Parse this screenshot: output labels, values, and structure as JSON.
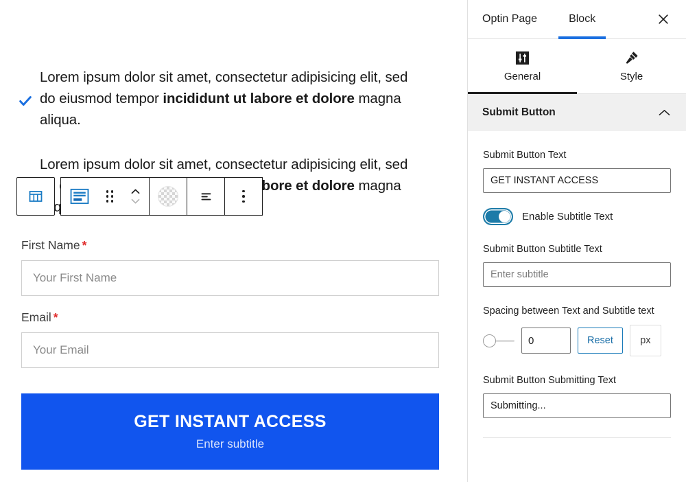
{
  "canvas": {
    "paragraph_1": {
      "part1": "Lorem ipsum dolor sit amet, consectetur adipisicing elit, sed do eiusmod tempor ",
      "bold": "incididunt ut labore et dolore",
      "part2": " magna aliqua."
    },
    "paragraph_2": {
      "part1": "Lorem ipsum dolor sit amet, consectetur adipisicing elit, sed do eiusmod tempor ",
      "bold": "incididunt ut labore et dolore",
      "part2": " magna aliqua."
    },
    "check_icon": "✔",
    "form": {
      "first_name_label": "First Name",
      "first_name_required": "*",
      "first_name_placeholder": "Your First Name",
      "email_label": "Email",
      "email_required": "*",
      "email_placeholder": "Your Email"
    },
    "submit_button": {
      "text": "GET INSTANT ACCESS",
      "subtitle": "Enter subtitle",
      "background_color": "#1155ee"
    },
    "toolbar": {
      "parent_block_icon": "columns-icon",
      "block_type_icon": "optin-form-block-icon",
      "drag_icon": "drag-handle-icon",
      "move_up_icon": "chevron-up-icon",
      "move_down_icon": "chevron-down-icon",
      "color_icon": "transparency-checker-icon",
      "align_icon": "align-icon",
      "more_icon": "more-options-icon"
    }
  },
  "panel": {
    "tabs": [
      {
        "label": "Optin Page",
        "active": false
      },
      {
        "label": "Block",
        "active": true
      }
    ],
    "close_icon": "close-icon",
    "sub_tabs": [
      {
        "label": "General",
        "icon": "sliders-icon",
        "active": true
      },
      {
        "label": "Style",
        "icon": "paintbrush-icon",
        "active": false
      }
    ],
    "section": {
      "title": "Submit Button",
      "collapse_icon": "chevron-up-icon"
    },
    "controls": {
      "submit_button_text_label": "Submit Button Text",
      "submit_button_text_value": "GET INSTANT ACCESS",
      "enable_subtitle_label": "Enable Subtitle Text",
      "enable_subtitle_state": "on",
      "subtitle_text_label": "Submit Button Subtitle Text",
      "subtitle_text_value": "",
      "subtitle_text_placeholder": "Enter subtitle",
      "spacing_label": "Spacing between Text and Subtitle text",
      "spacing_value": "0",
      "spacing_reset_label": "Reset",
      "spacing_unit": "px",
      "submitting_text_label": "Submit Button Submitting Text",
      "submitting_text_value": "Submitting..."
    },
    "accent_color": "#1a6fe0",
    "toggle_color": "#1d7ba8"
  }
}
